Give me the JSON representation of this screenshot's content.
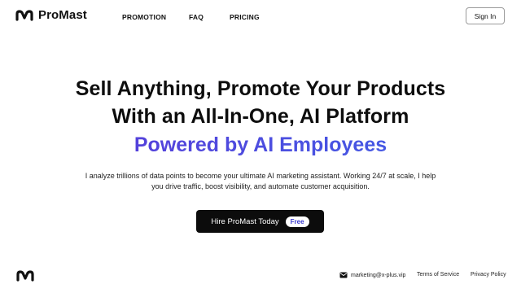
{
  "header": {
    "brand": "ProMast",
    "nav": [
      {
        "label": "PROMOTION"
      },
      {
        "label": "FAQ"
      },
      {
        "label": "PRICING"
      }
    ],
    "signin_label": "Sign In"
  },
  "hero": {
    "line1": "Sell Anything, Promote Your Products",
    "line2": "With an All-In-One, AI Platform",
    "accent": "Powered by AI Employees",
    "description": "I analyze trillions of data points to become your ultimate AI marketing assistant. Working 24/7 at scale, I help you drive traffic, boost visibility, and automate customer acquisition.",
    "cta_label": "Hire ProMast Today",
    "cta_badge": "Free"
  },
  "footer": {
    "email": "marketing@x-plus.vip",
    "links": [
      {
        "label": "Terms of Service"
      },
      {
        "label": "Privacy Policy"
      }
    ]
  },
  "colors": {
    "accent_start": "#5b35d6",
    "accent_end": "#3d63e8",
    "button_bg": "#0c0c0c"
  },
  "icons": {
    "logo": "promast-logo-icon",
    "email": "mail-icon"
  }
}
